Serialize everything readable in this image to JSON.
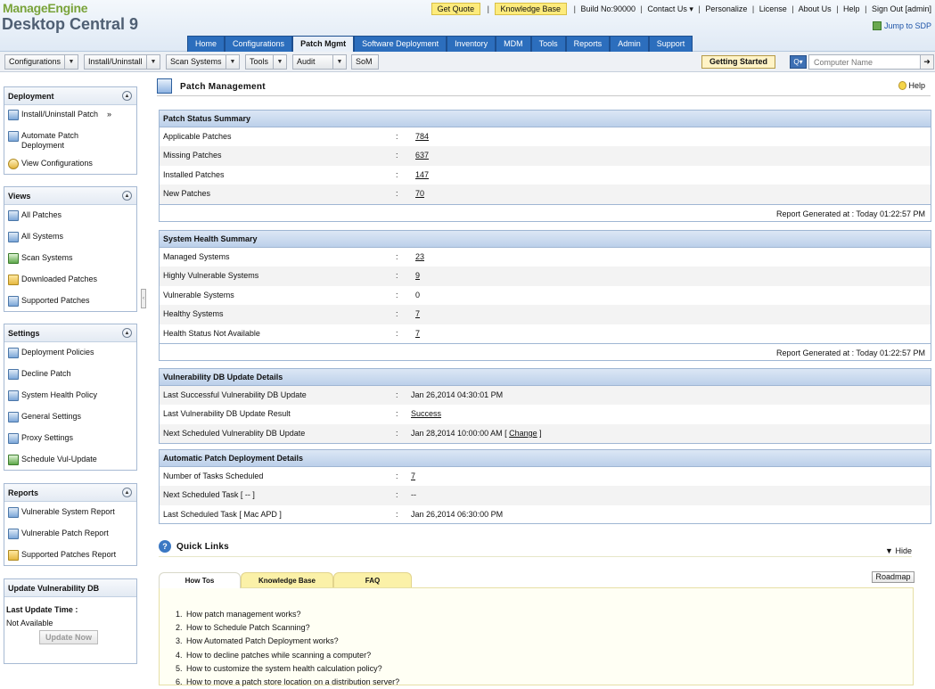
{
  "header": {
    "logo_top": "ManageEngine",
    "logo_main": "Desktop Central 9",
    "get_quote": "Get Quote",
    "knowledge_base": "Knowledge Base",
    "build": "Build No:90000",
    "contact_us": "Contact Us",
    "personalize": "Personalize",
    "license": "License",
    "about_us": "About Us",
    "help": "Help",
    "sign_out": "Sign Out",
    "user": "[admin]",
    "jump_sdp": "Jump to SDP"
  },
  "tabs": [
    "Home",
    "Configurations",
    "Patch Mgmt",
    "Software Deployment",
    "Inventory",
    "MDM",
    "Tools",
    "Reports",
    "Admin",
    "Support"
  ],
  "subbar": {
    "menus": [
      "Configurations",
      "Install/Uninstall",
      "Scan Systems",
      "Tools",
      "Audit"
    ],
    "som": "SoM",
    "getting_started": "Getting Started",
    "search_placeholder": "Computer Name"
  },
  "sidebar": {
    "deployment": {
      "title": "Deployment",
      "items": [
        "Install/Uninstall Patch",
        "Automate Patch Deployment",
        "View Configurations"
      ]
    },
    "views": {
      "title": "Views",
      "items": [
        "All Patches",
        "All Systems",
        "Scan Systems",
        "Downloaded Patches",
        "Supported Patches"
      ]
    },
    "settings": {
      "title": "Settings",
      "items": [
        "Deployment Policies",
        "Decline Patch",
        "System Health Policy",
        "General Settings",
        "Proxy Settings",
        "Schedule Vul-Update"
      ]
    },
    "reports": {
      "title": "Reports",
      "items": [
        "Vulnerable System Report",
        "Vulnerable Patch Report",
        "Supported Patches Report"
      ]
    },
    "update_db": {
      "title": "Update Vulnerability DB",
      "last_update_label": "Last Update Time :",
      "last_update_value": "Not Available",
      "button": "Update Now"
    }
  },
  "page": {
    "title": "Patch Management",
    "help": "Help"
  },
  "patch_status": {
    "title": "Patch Status Summary",
    "rows": [
      {
        "label": "Applicable Patches",
        "value": "784"
      },
      {
        "label": "Missing Patches",
        "value": "637"
      },
      {
        "label": "Installed Patches",
        "value": "147"
      },
      {
        "label": "New Patches",
        "value": "70"
      }
    ],
    "footer": "Report Generated at : Today 01:22:57 PM"
  },
  "system_health": {
    "title": "System Health Summary",
    "rows": [
      {
        "label": "Managed Systems",
        "value": "23"
      },
      {
        "label": "Highly Vulnerable Systems",
        "value": "9"
      },
      {
        "label": "Vulnerable Systems",
        "value": "0"
      },
      {
        "label": "Healthy Systems",
        "value": "7"
      },
      {
        "label": "Health Status Not Available",
        "value": "7"
      }
    ],
    "footer": "Report Generated at : Today 01:22:57 PM"
  },
  "vuln_db": {
    "title": "Vulnerability DB Update Details",
    "rows": [
      {
        "label": "Last Successful Vulnerability DB Update",
        "value": "Jan 26,2014 04:30:01 PM"
      },
      {
        "label": "Last Vulnerability DB Update Result",
        "value": "Success"
      },
      {
        "label": "Next Scheduled Vulnerablity DB Update",
        "value": "Jan 28,2014 10:00:00 AM [",
        "change": "Change",
        "end": "]"
      }
    ]
  },
  "auto_deploy": {
    "title": "Automatic Patch Deployment Details",
    "rows": [
      {
        "label": "Number of Tasks Scheduled",
        "value": "7"
      },
      {
        "label": "Next Scheduled Task [ -- ]",
        "value": "--"
      },
      {
        "label": "Last Scheduled Task [ Mac APD ]",
        "value": "Jan 26,2014 06:30:00 PM"
      }
    ]
  },
  "quick_links": {
    "title": "Quick Links",
    "hide": "Hide",
    "tabs": [
      "How Tos",
      "Knowledge Base",
      "FAQ"
    ],
    "roadmap": "Roadmap",
    "howtos": [
      "How patch management works?",
      "How to Schedule Patch Scanning?",
      "How Automated Patch Deployment works?",
      "How to decline patches while scanning a computer?",
      "How to customize the system health calculation policy?",
      "How to move a patch store location on a distribution server?"
    ]
  }
}
